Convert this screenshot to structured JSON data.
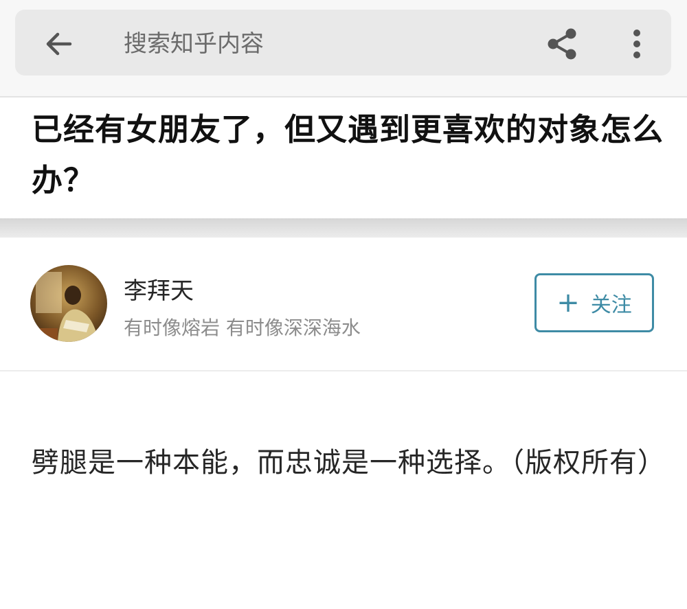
{
  "search": {
    "placeholder": "搜索知乎内容"
  },
  "question": {
    "title": "已经有女朋友了，但又遇到更喜欢的对象怎么办？"
  },
  "author": {
    "name": "李拜天",
    "bio": "有时像熔岩 有时像深深海水"
  },
  "follow_button": {
    "plus": "+",
    "label": "关注"
  },
  "answer": {
    "text": "劈腿是一种本能，而忠诚是一种选择。（版权所有）"
  },
  "icons": {
    "back": "arrow-left-icon",
    "share": "share-icon",
    "more": "more-vertical-icon"
  },
  "colors": {
    "accent": "#3e8ba5",
    "searchbar": "#e9e9e9"
  }
}
